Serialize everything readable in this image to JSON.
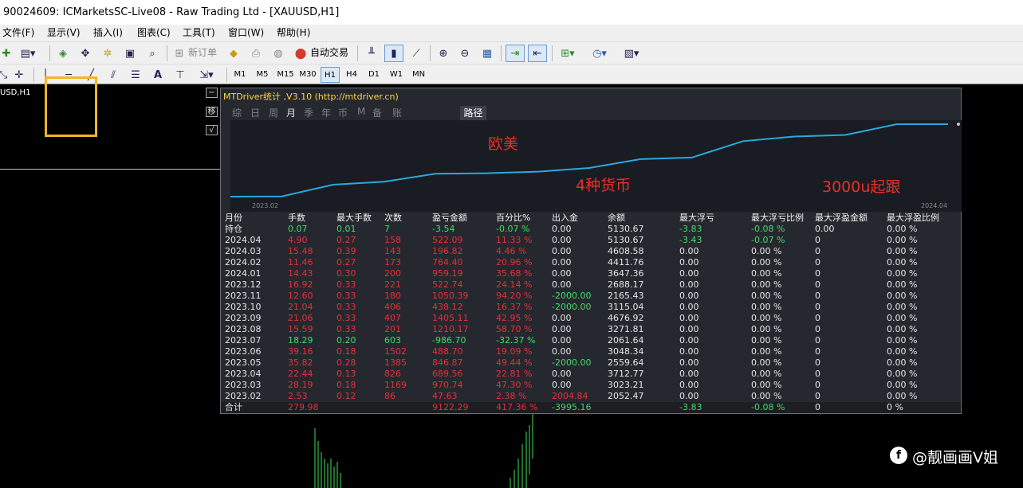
{
  "window": {
    "title": "90024609: ICMarketsSC-Live08 - Raw Trading Ltd - [XAUUSD,H1]"
  },
  "menu": [
    "文件(F)",
    "显示(V)",
    "插入(I)",
    "图表(C)",
    "工具(T)",
    "窗口(W)",
    "帮助(H)"
  ],
  "toolbar": {
    "new_order": "新订单",
    "auto_trading": "自动交易"
  },
  "timeframes": [
    "M1",
    "M5",
    "M15",
    "M30",
    "H1",
    "H4",
    "D1",
    "W1",
    "MN"
  ],
  "active_timeframe": "H1",
  "chart": {
    "symbol_label": "USD,H1"
  },
  "panel": {
    "title": "MTDriver统计 ,V3.10 (http://mtdriver.cn)",
    "tabs": [
      "综",
      "日",
      "周",
      "月",
      "季",
      "年",
      "币",
      "M",
      "备",
      "账户"
    ],
    "active_tab": "月",
    "route_btn": "路径",
    "graph": {
      "x_start": "2023.02",
      "x_end": "2024.04",
      "balance": [
        2052.47,
        2061.64,
        2559.64,
        2688.17,
        3023.21,
        3048.34,
        3115.04,
        3271.81,
        3647.36,
        3712.77,
        4411.76,
        4608.58,
        4676.92,
        5130.67,
        5130.67
      ],
      "line_color": "#29a8e0"
    },
    "columns": [
      "月份",
      "手数",
      "最大手数",
      "次数",
      "盈亏金额",
      "百分比%",
      "出入金",
      "余额",
      "最大浮亏",
      "最大浮亏比例",
      "最大浮盈金额",
      "最大浮盈比例"
    ],
    "position_row": {
      "month": "持仓",
      "lots": "0.07",
      "max_lots": "0.01",
      "count": "7",
      "pnl": "-3.54",
      "pct": "-0.07 %",
      "flow": "0.00",
      "balance": "5130.67",
      "max_dd": "-3.83",
      "max_dd_pct": "-0.08 %",
      "max_fp": "0.00",
      "max_fp_pct": "0.00 %"
    },
    "rows": [
      {
        "month": "2024.04",
        "lots": "4.90",
        "max_lots": "0.27",
        "count": "158",
        "pnl": "522.09",
        "pct": "11.33 %",
        "flow": "0.00",
        "balance": "5130.67",
        "max_dd": "-3.43",
        "max_dd_pct": "-0.07 %",
        "max_fp": "0",
        "max_fp_pct": "0.00 %"
      },
      {
        "month": "2024.03",
        "lots": "15.48",
        "max_lots": "0.39",
        "count": "143",
        "pnl": "196.82",
        "pct": "4.46 %",
        "flow": "0.00",
        "balance": "4608.58",
        "max_dd": "0.00",
        "max_dd_pct": "0.00 %",
        "max_fp": "0",
        "max_fp_pct": "0.00 %"
      },
      {
        "month": "2024.02",
        "lots": "11.46",
        "max_lots": "0.27",
        "count": "173",
        "pnl": "764.40",
        "pct": "20.96 %",
        "flow": "0.00",
        "balance": "4411.76",
        "max_dd": "0.00",
        "max_dd_pct": "0.00 %",
        "max_fp": "0",
        "max_fp_pct": "0.00 %"
      },
      {
        "month": "2024.01",
        "lots": "14.43",
        "max_lots": "0.30",
        "count": "200",
        "pnl": "959.19",
        "pct": "35.68 %",
        "flow": "0.00",
        "balance": "3647.36",
        "max_dd": "0.00",
        "max_dd_pct": "0.00 %",
        "max_fp": "0",
        "max_fp_pct": "0.00 %"
      },
      {
        "month": "2023.12",
        "lots": "16.92",
        "max_lots": "0.33",
        "count": "221",
        "pnl": "522.74",
        "pct": "24.14 %",
        "flow": "0.00",
        "balance": "2688.17",
        "max_dd": "0.00",
        "max_dd_pct": "0.00 %",
        "max_fp": "0",
        "max_fp_pct": "0.00 %"
      },
      {
        "month": "2023.11",
        "lots": "12.60",
        "max_lots": "0.33",
        "count": "180",
        "pnl": "1050.39",
        "pct": "94.20 %",
        "flow": "-2000.00",
        "balance": "2165.43",
        "max_dd": "0.00",
        "max_dd_pct": "0.00 %",
        "max_fp": "0",
        "max_fp_pct": "0.00 %"
      },
      {
        "month": "2023.10",
        "lots": "21.04",
        "max_lots": "0.33",
        "count": "406",
        "pnl": "438.12",
        "pct": "16.37 %",
        "flow": "-2000.00",
        "balance": "3115.04",
        "max_dd": "0.00",
        "max_dd_pct": "0.00 %",
        "max_fp": "0",
        "max_fp_pct": "0.00 %"
      },
      {
        "month": "2023.09",
        "lots": "21.06",
        "max_lots": "0.33",
        "count": "407",
        "pnl": "1405.11",
        "pct": "42.95 %",
        "flow": "0.00",
        "balance": "4676.92",
        "max_dd": "0.00",
        "max_dd_pct": "0.00 %",
        "max_fp": "0",
        "max_fp_pct": "0.00 %"
      },
      {
        "month": "2023.08",
        "lots": "15.59",
        "max_lots": "0.33",
        "count": "201",
        "pnl": "1210.17",
        "pct": "58.70 %",
        "flow": "0.00",
        "balance": "3271.81",
        "max_dd": "0.00",
        "max_dd_pct": "0.00 %",
        "max_fp": "0",
        "max_fp_pct": "0.00 %"
      },
      {
        "month": "2023.07",
        "lots": "18.29",
        "max_lots": "0.20",
        "count": "603",
        "pnl": "-986.70",
        "pct": "-32.37 %",
        "flow": "0.00",
        "balance": "2061.64",
        "max_dd": "0.00",
        "max_dd_pct": "0.00 %",
        "max_fp": "0",
        "max_fp_pct": "0.00 %"
      },
      {
        "month": "2023.06",
        "lots": "39.16",
        "max_lots": "0.18",
        "count": "1502",
        "pnl": "488.70",
        "pct": "19.09 %",
        "flow": "0.00",
        "balance": "3048.34",
        "max_dd": "0.00",
        "max_dd_pct": "0.00 %",
        "max_fp": "0",
        "max_fp_pct": "0.00 %"
      },
      {
        "month": "2023.05",
        "lots": "35.82",
        "max_lots": "0.28",
        "count": "1385",
        "pnl": "846.87",
        "pct": "49.44 %",
        "flow": "-2000.00",
        "balance": "2559.64",
        "max_dd": "0.00",
        "max_dd_pct": "0.00 %",
        "max_fp": "0",
        "max_fp_pct": "0.00 %"
      },
      {
        "month": "2023.04",
        "lots": "22.44",
        "max_lots": "0.13",
        "count": "826",
        "pnl": "689.56",
        "pct": "22.81 %",
        "flow": "0.00",
        "balance": "3712.77",
        "max_dd": "0.00",
        "max_dd_pct": "0.00 %",
        "max_fp": "0",
        "max_fp_pct": "0.00 %"
      },
      {
        "month": "2023.03",
        "lots": "28.19",
        "max_lots": "0.18",
        "count": "1169",
        "pnl": "970.74",
        "pct": "47.30 %",
        "flow": "0.00",
        "balance": "3023.21",
        "max_dd": "0.00",
        "max_dd_pct": "0.00 %",
        "max_fp": "0",
        "max_fp_pct": "0.00 %"
      },
      {
        "month": "2023.02",
        "lots": "2.53",
        "max_lots": "0.12",
        "count": "86",
        "pnl": "47.63",
        "pct": "2.38 %",
        "flow": "2004.84",
        "balance": "2052.47",
        "max_dd": "0.00",
        "max_dd_pct": "0.00 %",
        "max_fp": "0",
        "max_fp_pct": "0.00 %"
      }
    ],
    "total_row": {
      "month": "合计",
      "lots": "279.98",
      "max_lots": "",
      "count": "",
      "pnl": "9122.29",
      "pct": "417.36 %",
      "flow": "-3995.16",
      "balance": "",
      "max_dd": "-3.83",
      "max_dd_pct": "-0.08 %",
      "max_fp": "0",
      "max_fp_pct": "0 %"
    }
  },
  "annotations": {
    "region": "欧美",
    "currencies": "4种货币",
    "follow": "3000u起跟"
  },
  "watermark": {
    "text": "@靓画画V姐"
  },
  "colors": {
    "panel_bg": "#25282e",
    "positive": "#e6303a",
    "negative": "#42dc6c",
    "highlight_box": "#f2b52a",
    "title_text": "#ffd24a"
  }
}
